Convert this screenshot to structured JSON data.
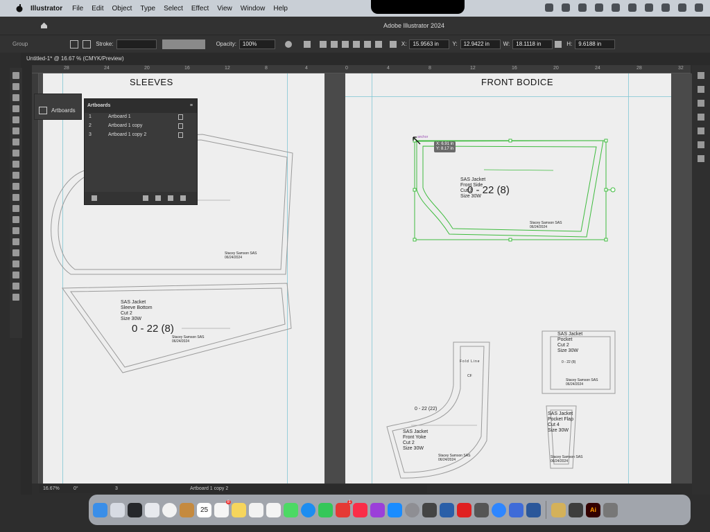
{
  "menubar": {
    "app_name": "Illustrator",
    "items": [
      "File",
      "Edit",
      "Object",
      "Type",
      "Select",
      "Effect",
      "View",
      "Window",
      "Help"
    ]
  },
  "window": {
    "title": "Adobe Illustrator 2024",
    "doc_tab": "Untitled-1* @ 16.67 % (CMYK/Preview)"
  },
  "control_bar": {
    "selection_label": "Group",
    "stroke_label": "Stroke:",
    "opacity_label": "Opacity:",
    "opacity_value": "100%",
    "x_label": "X:",
    "x_value": "15.9563 in",
    "y_label": "Y:",
    "y_value": "12.9422 in",
    "w_label": "W:",
    "w_value": "18.1118 in",
    "h_label": "H:",
    "h_value": "9.6188 in"
  },
  "ruler": {
    "h_ticks": [
      "28",
      "24",
      "20",
      "16",
      "12",
      "8",
      "4",
      "0",
      "4",
      "8",
      "12",
      "16",
      "20",
      "24",
      "28",
      "32"
    ]
  },
  "artboards": {
    "sleeves": {
      "title": "SLEEVES",
      "sleeve_top_sig": "Stacey Samson SAS\n06/24/2024",
      "sleeve_bottom_label": "SAS Jacket\nSleeve Bottom\nCut 2\nSize 30W",
      "sleeve_bottom_size": "0 - 22 (8)",
      "sleeve_bottom_sig": "Stacey Samson SAS\n06/24/2024"
    },
    "front_bodice": {
      "title": "FRONT BODICE",
      "anchor_label": "anchor",
      "tooltip_x": "X: 6.91 in",
      "tooltip_y": "Y: 8.17 in",
      "front_side_label": "SAS Jacket\nFront Side\nCut 2\nSize 30W",
      "front_side_size": "0 - 22 (8)",
      "front_side_sig": "Stacey Samson SAS\n06/24/2024",
      "pocket_label": "SAS Jacket\nPocket\nCut 2\nSize 30W",
      "pocket_size": "0 - 22 (8)",
      "pocket_sig": "Stacey Samson SAS\n06/24/2024",
      "fold_line": "Fold Line",
      "cf": "CF",
      "yoke_size": "0 - 22 (22)",
      "yoke_label": "SAS Jacket\nFront Yoke\nCut 2\nSize 30W",
      "yoke_sig": "Stacey Samson SAS\n06/24/2024",
      "flap_label": "SAS Jacket\nPocket Flap\nCut 4\nSize 30W",
      "flap_sig": "Stacey Samson SAS\n06/24/2024"
    }
  },
  "panel": {
    "tab_title": "Artboards",
    "header": "Artboards",
    "rows": [
      {
        "num": "1",
        "name": "Artboard 1"
      },
      {
        "num": "2",
        "name": "Artboard 1 copy"
      },
      {
        "num": "3",
        "name": "Artboard 1 copy 2"
      }
    ]
  },
  "statusbar": {
    "zoom": "16.67%",
    "rotation": "0°",
    "page": "3",
    "artboard_name": "Artboard 1 copy 2"
  },
  "dock": {
    "calendar_day": "25",
    "calendar_month": "JUN",
    "badge_reminders": "8",
    "badge_news": "1"
  },
  "colors": {
    "selection_green": "#3dbb3d",
    "guide_cyan": "#7fc5d3",
    "canvas_bg": "#4a4a4a",
    "artboard_bg": "#eeeeee"
  }
}
